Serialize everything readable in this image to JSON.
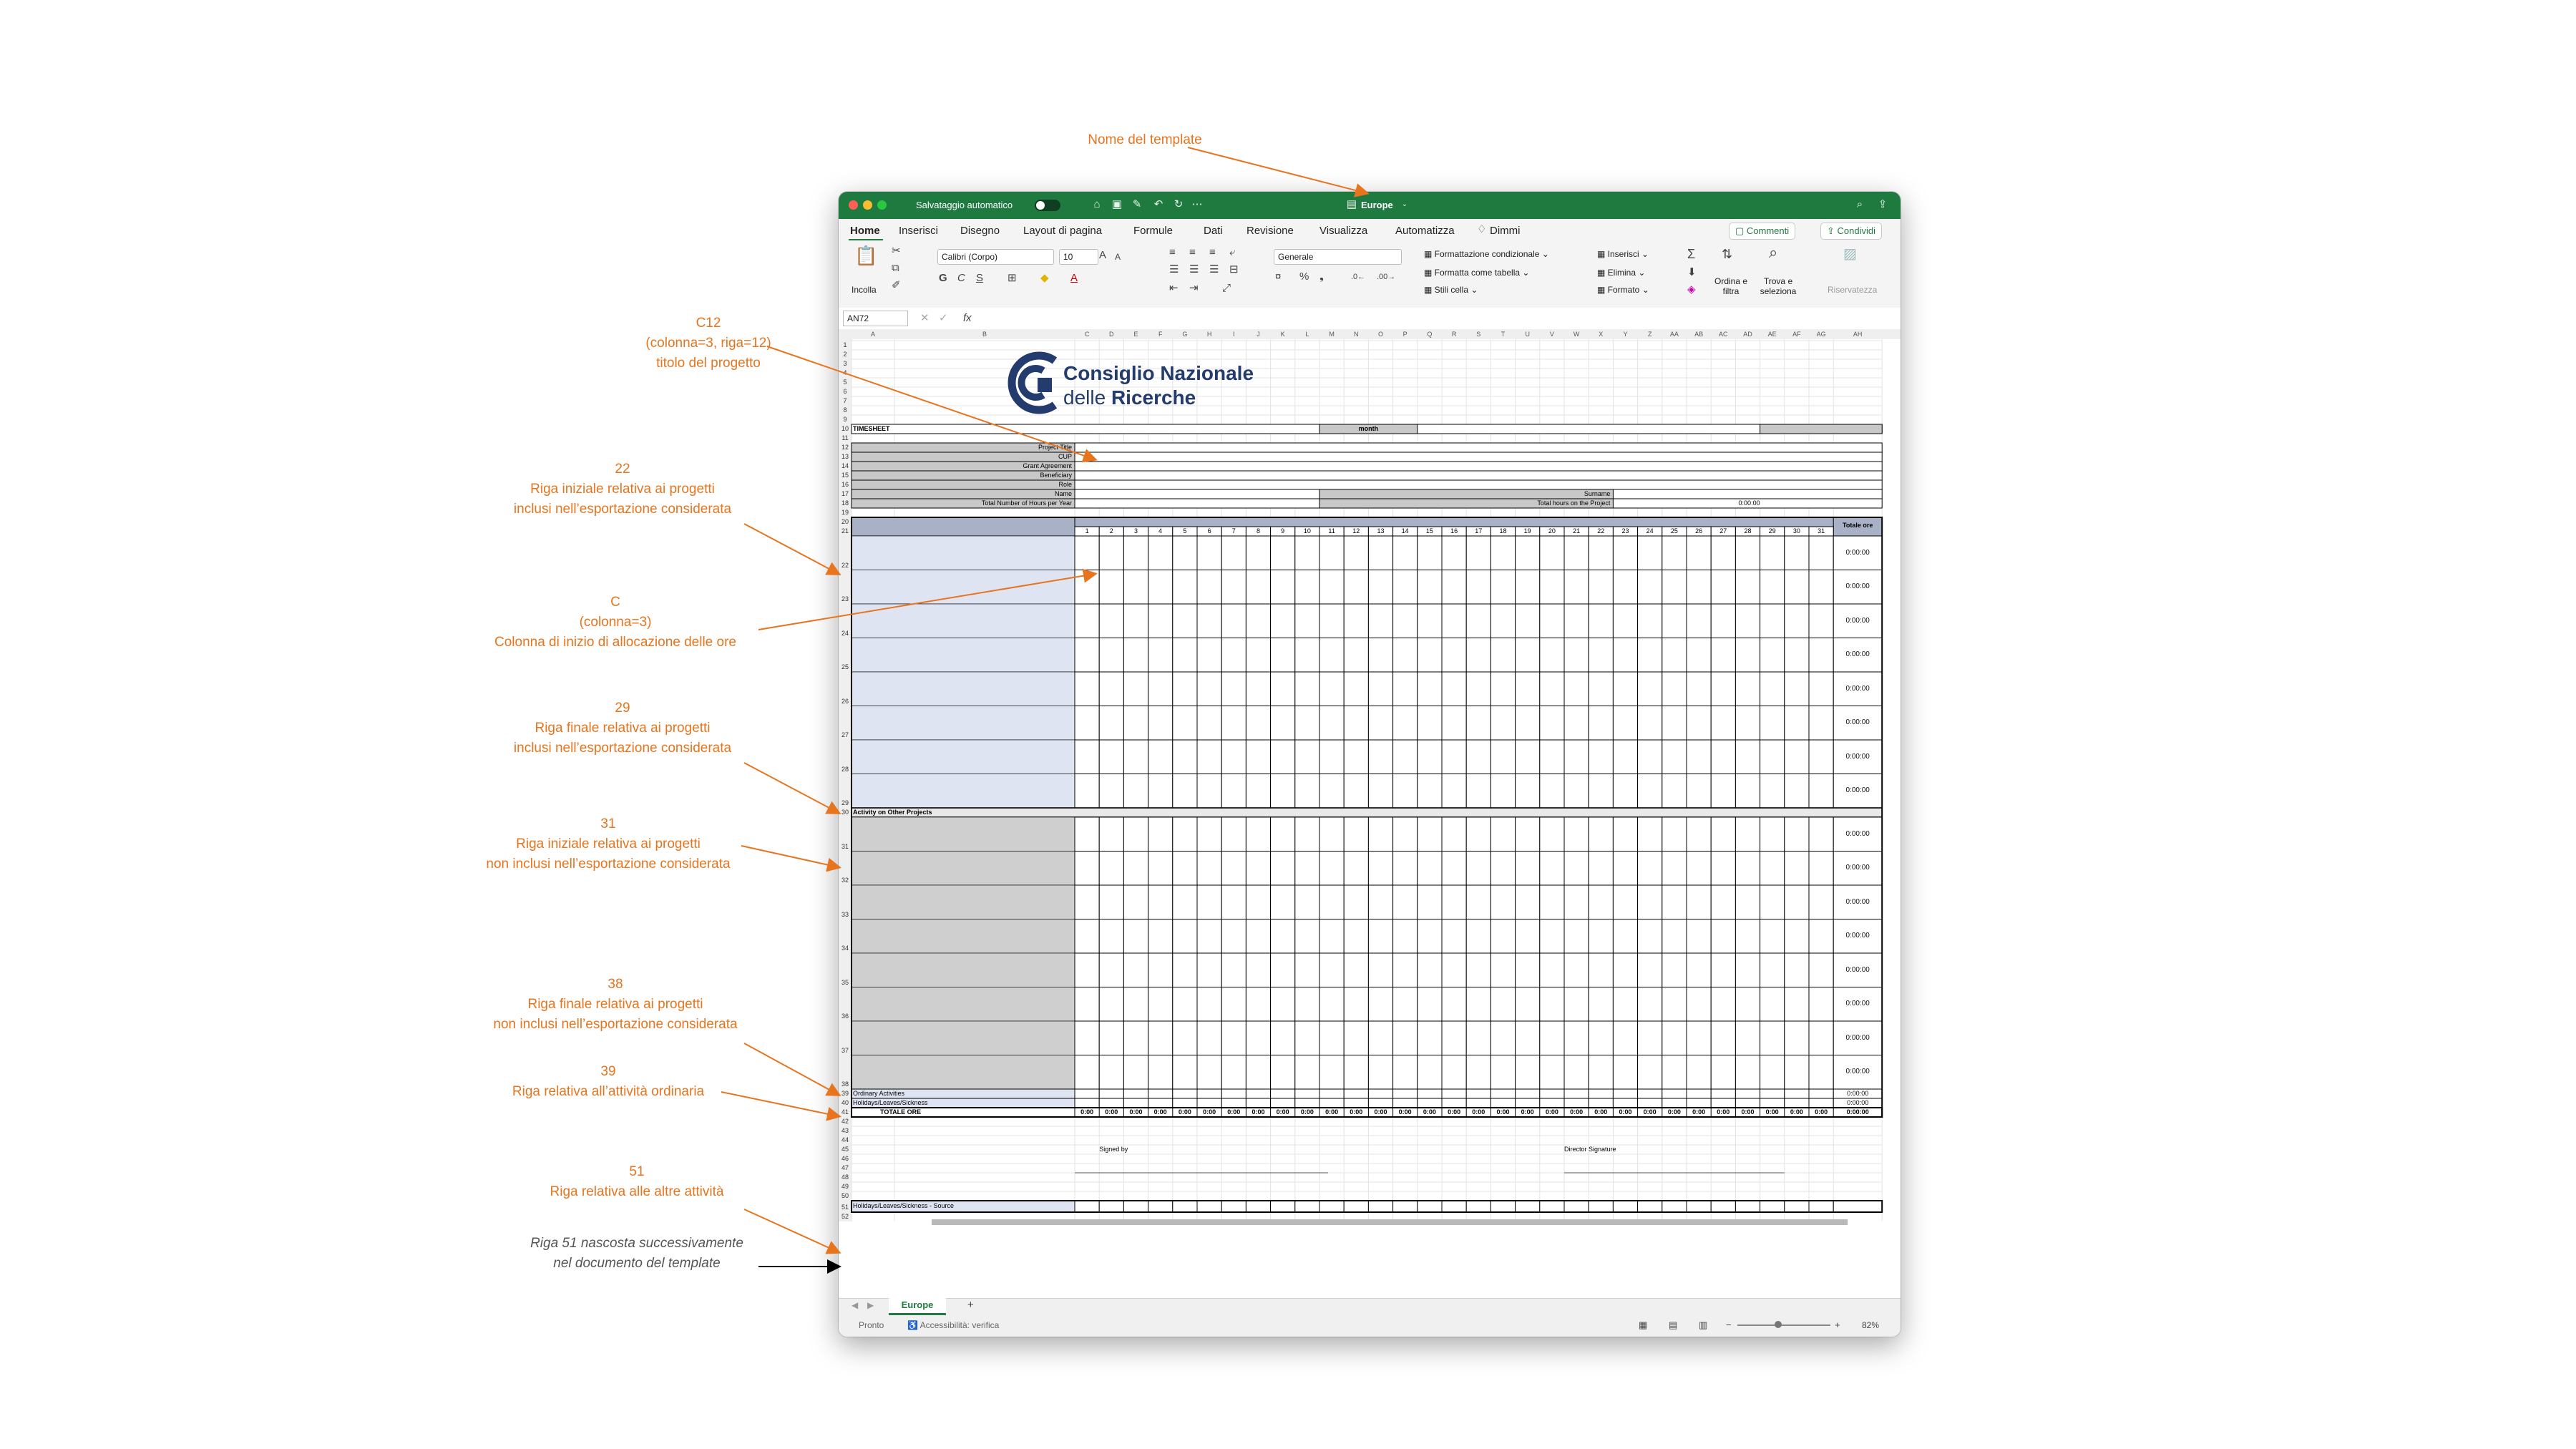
{
  "annotations": {
    "template_name": "Nome del template",
    "c12": [
      "C12",
      "(colonna=3, riga=12)",
      "titolo del progetto"
    ],
    "row22": [
      "22",
      "Riga iniziale relativa ai progetti",
      "inclusi nell’esportazione considerata"
    ],
    "colc": [
      "C",
      "(colonna=3)",
      "Colonna di inizio di allocazione delle ore"
    ],
    "row29": [
      "29",
      "Riga finale relativa ai progetti",
      "inclusi nell’esportazione considerata"
    ],
    "row31": [
      "31",
      "Riga iniziale relativa ai progetti",
      "non inclusi nell’esportazione considerata"
    ],
    "row38": [
      "38",
      "Riga finale relativa ai progetti",
      "non inclusi nell’esportazione considerata"
    ],
    "row39": [
      "39",
      "Riga relativa all’attività ordinaria"
    ],
    "row51": [
      "51",
      "Riga relativa alle altre attività"
    ],
    "note51": [
      "Riga 51 nascosta successivamente",
      "nel documento del template"
    ]
  },
  "window": {
    "autosave": "Salvataggio automatico",
    "title": "Europe",
    "tabs": [
      "Home",
      "Inserisci",
      "Disegno",
      "Layout di pagina",
      "Formule",
      "Dati",
      "Revisione",
      "Visualizza",
      "Automatizza",
      "Dimmi"
    ],
    "comments_btn": "Commenti",
    "share_btn": "Condividi"
  },
  "ribbon": {
    "paste": "Incolla",
    "font_name": "Calibri (Corpo)",
    "font_size": "10",
    "number_format": "Generale",
    "cond_format": "Formattazione condizionale",
    "format_table": "Formatta come tabella",
    "cell_styles": "Stili cella",
    "insert": "Inserisci",
    "delete": "Elimina",
    "format": "Formato",
    "sort": "Ordina e filtra",
    "find": "Trova e seleziona",
    "privacy": "Riservatezza"
  },
  "formula_bar": {
    "cell_ref": "AN72",
    "fx": "fx"
  },
  "sheet": {
    "logo_line1": "Consiglio Nazionale",
    "logo_line2a": "delle ",
    "logo_line2b": "Ricerche",
    "timesheet": "TIMESHEET",
    "month": "month",
    "labels": [
      "Project Title",
      "CUP",
      "Grant Agreement",
      "Beneficiary",
      "Role",
      "Name",
      "Total Number of Hours per Year"
    ],
    "surname": "Surname",
    "total_hours_project": "Total hours on the Project",
    "total_hours_value": "0:00:00",
    "totale_ore_hdr": "Totale ore",
    "activity_other": "Activity on Other Projects",
    "ordinary": "Ordinary Activities",
    "holidays": "Holidays/Leaves/Sickness",
    "totale_ore_row": "TOTALE ORE",
    "zero_short": "0:00",
    "zero_long": "0:00:00",
    "signed_by": "Signed by",
    "director_signature": "Director Signature",
    "holidays_source": "Holidays/Leaves/Sickness - Source",
    "columns": [
      "A",
      "B",
      "C",
      "D",
      "E",
      "F",
      "G",
      "H",
      "I",
      "J",
      "K",
      "L",
      "M",
      "N",
      "O",
      "P",
      "Q",
      "R",
      "S",
      "T",
      "U",
      "V",
      "W",
      "X",
      "Y",
      "Z",
      "AA",
      "AB",
      "AC",
      "AD",
      "AE",
      "AF",
      "AG",
      "AH"
    ],
    "days": [
      "1",
      "2",
      "3",
      "4",
      "5",
      "6",
      "7",
      "8",
      "9",
      "10",
      "11",
      "12",
      "13",
      "14",
      "15",
      "16",
      "17",
      "18",
      "19",
      "20",
      "21",
      "22",
      "23",
      "24",
      "25",
      "26",
      "27",
      "28",
      "29",
      "30",
      "31"
    ]
  },
  "statusbar": {
    "sheet_tab": "Europe",
    "ready": "Pronto",
    "accessibility": "Accessibilità: verifica",
    "zoom": "82%"
  }
}
